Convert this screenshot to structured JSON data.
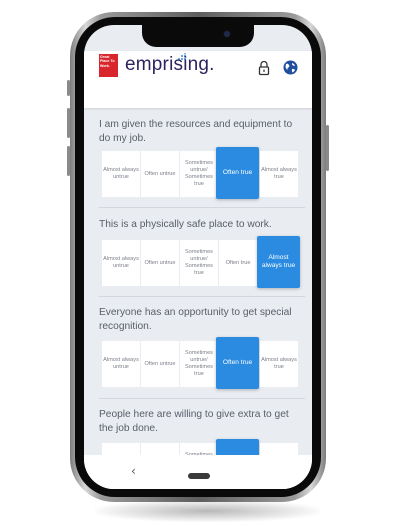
{
  "header": {
    "badge_text": "Great Place To Work.",
    "brand_name": "emprising."
  },
  "icons": {
    "lock": "lock-icon",
    "globe": "globe-icon",
    "back": "chevron-left-icon"
  },
  "colors": {
    "selected": "#2a8be0",
    "brand": "#2c2460",
    "badge": "#d9262c"
  },
  "options": [
    "Almost always untrue",
    "Often untrue",
    "Sometimes untrue/ Sometimes true",
    "Often true",
    "Almost always true"
  ],
  "questions": [
    {
      "text": "I am given the resources and equipment to do my job.",
      "selected": 3
    },
    {
      "text": "This is a physically safe place to work.",
      "selected": 4
    },
    {
      "text": "Everyone has an opportunity to get special recognition.",
      "selected": 3
    },
    {
      "text": "People here are willing to give extra to get the job done.",
      "selected": 3
    }
  ],
  "nav": {
    "back": "‹"
  }
}
